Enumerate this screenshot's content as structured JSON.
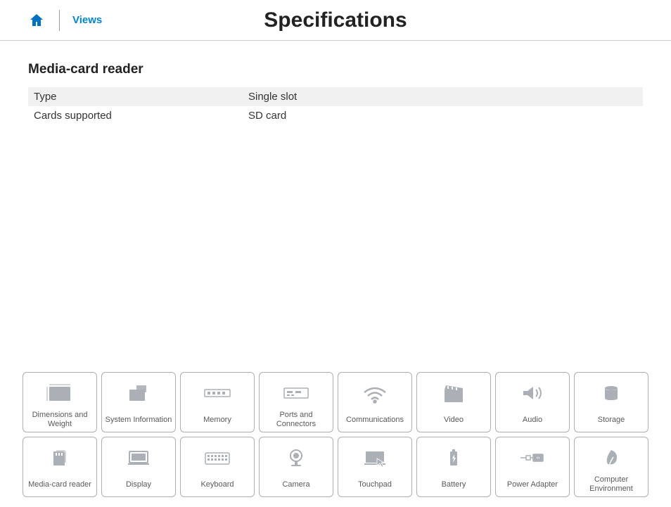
{
  "header": {
    "views_label": "Views",
    "page_title": "Specifications"
  },
  "section": {
    "title": "Media-card reader",
    "rows": [
      {
        "label": "Type",
        "value": "Single slot"
      },
      {
        "label": "Cards supported",
        "value": "SD card"
      }
    ]
  },
  "nav_tiles_row1": [
    {
      "label": "Dimensions and Weight",
      "icon": "dimensions"
    },
    {
      "label": "System Information",
      "icon": "system"
    },
    {
      "label": "Memory",
      "icon": "memory"
    },
    {
      "label": "Ports and Connectors",
      "icon": "ports"
    },
    {
      "label": "Communications",
      "icon": "wifi"
    },
    {
      "label": "Video",
      "icon": "video"
    },
    {
      "label": "Audio",
      "icon": "audio"
    },
    {
      "label": "Storage",
      "icon": "storage"
    }
  ],
  "nav_tiles_row2": [
    {
      "label": "Media-card reader",
      "icon": "mediacard"
    },
    {
      "label": "Display",
      "icon": "display"
    },
    {
      "label": "Keyboard",
      "icon": "keyboard"
    },
    {
      "label": "Camera",
      "icon": "camera"
    },
    {
      "label": "Touchpad",
      "icon": "touchpad"
    },
    {
      "label": "Battery",
      "icon": "battery"
    },
    {
      "label": "Power Adapter",
      "icon": "power"
    },
    {
      "label": "Computer Environment",
      "icon": "environment"
    }
  ]
}
